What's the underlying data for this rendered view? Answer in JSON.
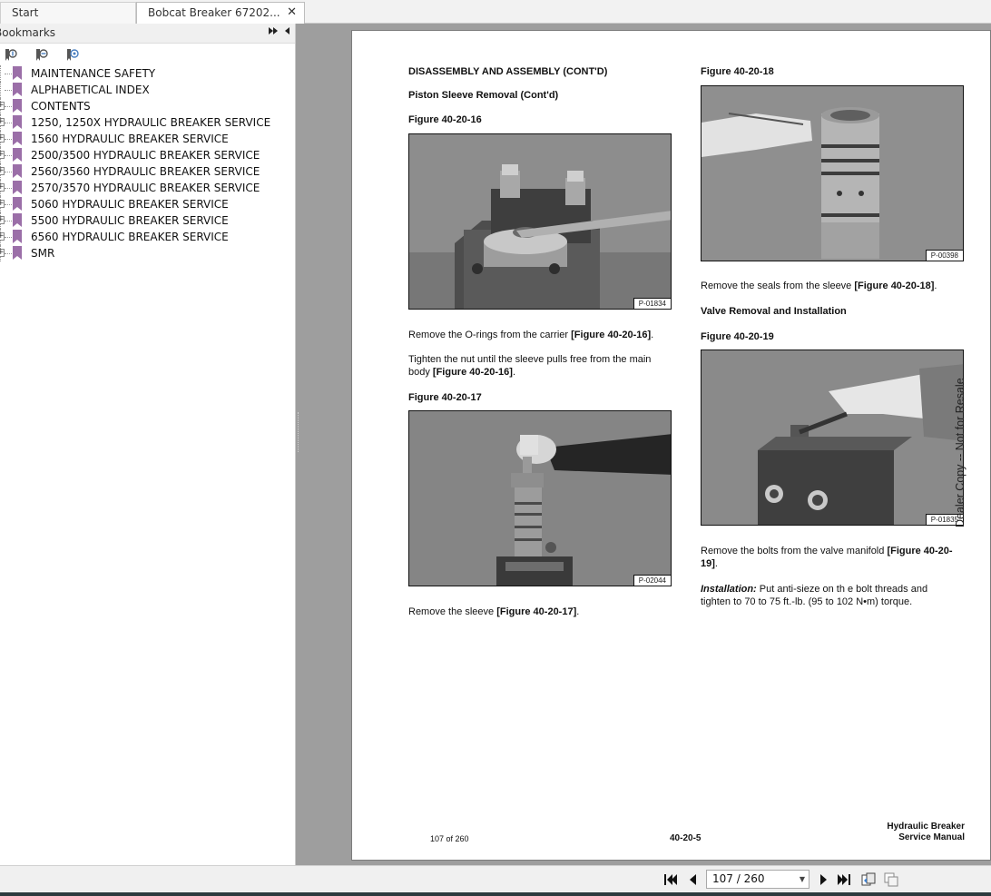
{
  "tabs": {
    "start": "Start",
    "document": "Bobcat Breaker 67202...",
    "close_glyph": "✕"
  },
  "sidebar": {
    "title": "Bookmarks",
    "collapse_glyph": "⏩",
    "pin_glyph": "◂",
    "toolbar_icons": [
      "bookmark-expand-icon",
      "bookmark-collapse-icon",
      "bookmark-find-icon"
    ],
    "items": [
      {
        "label": "MAINTENANCE SAFETY",
        "expandable": false
      },
      {
        "label": "ALPHABETICAL INDEX",
        "expandable": false
      },
      {
        "label": "CONTENTS",
        "expandable": true
      },
      {
        "label": "1250, 1250X HYDRAULIC BREAKER SERVICE",
        "expandable": true
      },
      {
        "label": "1560 HYDRAULIC BREAKER SERVICE",
        "expandable": true
      },
      {
        "label": "2500/3500 HYDRAULIC BREAKER SERVICE",
        "expandable": true
      },
      {
        "label": "2560/3560 HYDRAULIC BREAKER SERVICE",
        "expandable": true
      },
      {
        "label": "2570/3570 HYDRAULIC BREAKER SERVICE",
        "expandable": true
      },
      {
        "label": "5060 HYDRAULIC BREAKER SERVICE",
        "expandable": true
      },
      {
        "label": "5500 HYDRAULIC BREAKER SERVICE",
        "expandable": true
      },
      {
        "label": "6560 HYDRAULIC BREAKER SERVICE",
        "expandable": true
      },
      {
        "label": "SMR",
        "expandable": true
      }
    ]
  },
  "page": {
    "heading": "DISASSEMBLY AND ASSEMBLY (CONT'D)",
    "subheading": "Piston Sleeve Removal (Cont'd)",
    "fig16": {
      "title": "Figure 40-20-16",
      "code": "P-01834"
    },
    "p1_text": "Remove the O-rings from the carrier ",
    "p1_ref": "[Figure 40-20-16]",
    "p2_line1": "Tighten the nut until the sleeve pulls free from the main",
    "p2_line2": "body ",
    "p2_ref": "[Figure 40-20-16]",
    "fig17": {
      "title": "Figure 40-20-17",
      "code": "P-02044"
    },
    "p3_text": "Remove the sleeve ",
    "p3_ref": "[Figure 40-20-17]",
    "fig18": {
      "title": "Figure 40-20-18",
      "code": "P-00398"
    },
    "p4_text": "Remove the seals from the sleeve ",
    "p4_ref": "[Figure 40-20-18]",
    "subheading2": "Valve Removal and Installation",
    "fig19": {
      "title": "Figure 40-20-19",
      "code": "P-01835"
    },
    "p5_line1_text": "Remove the bolts from the valve manifold ",
    "p5_line1_ref": "[Figure 40-20-",
    "p5_line2_ref": "19]",
    "p6_label": "Installation:",
    "p6_line1": " Put anti-sieze on th e bolt threads and",
    "p6_line2": "tighten to 70 to 75 ft.-lb. (95 to 102 N•m) torque.",
    "watermark": "Dealer Copy -- Not for Resale",
    "footer_left": "107 of 260",
    "footer_center": "40-20-5",
    "footer_right1": "Hydraulic Breaker",
    "footer_right2": "Service Manual"
  },
  "navigation": {
    "page_value": "107 / 260",
    "current_page": 107,
    "total_pages": 260,
    "icons": [
      "first-page-icon",
      "previous-page-icon",
      "next-page-icon",
      "last-page-icon",
      "page-layout-icon",
      "view-mode-icon"
    ]
  },
  "colors": {
    "bookmark_flag": "#9b6fa8",
    "viewer_bg": "#9e9e9e",
    "status_line": "#2d3a3e"
  }
}
